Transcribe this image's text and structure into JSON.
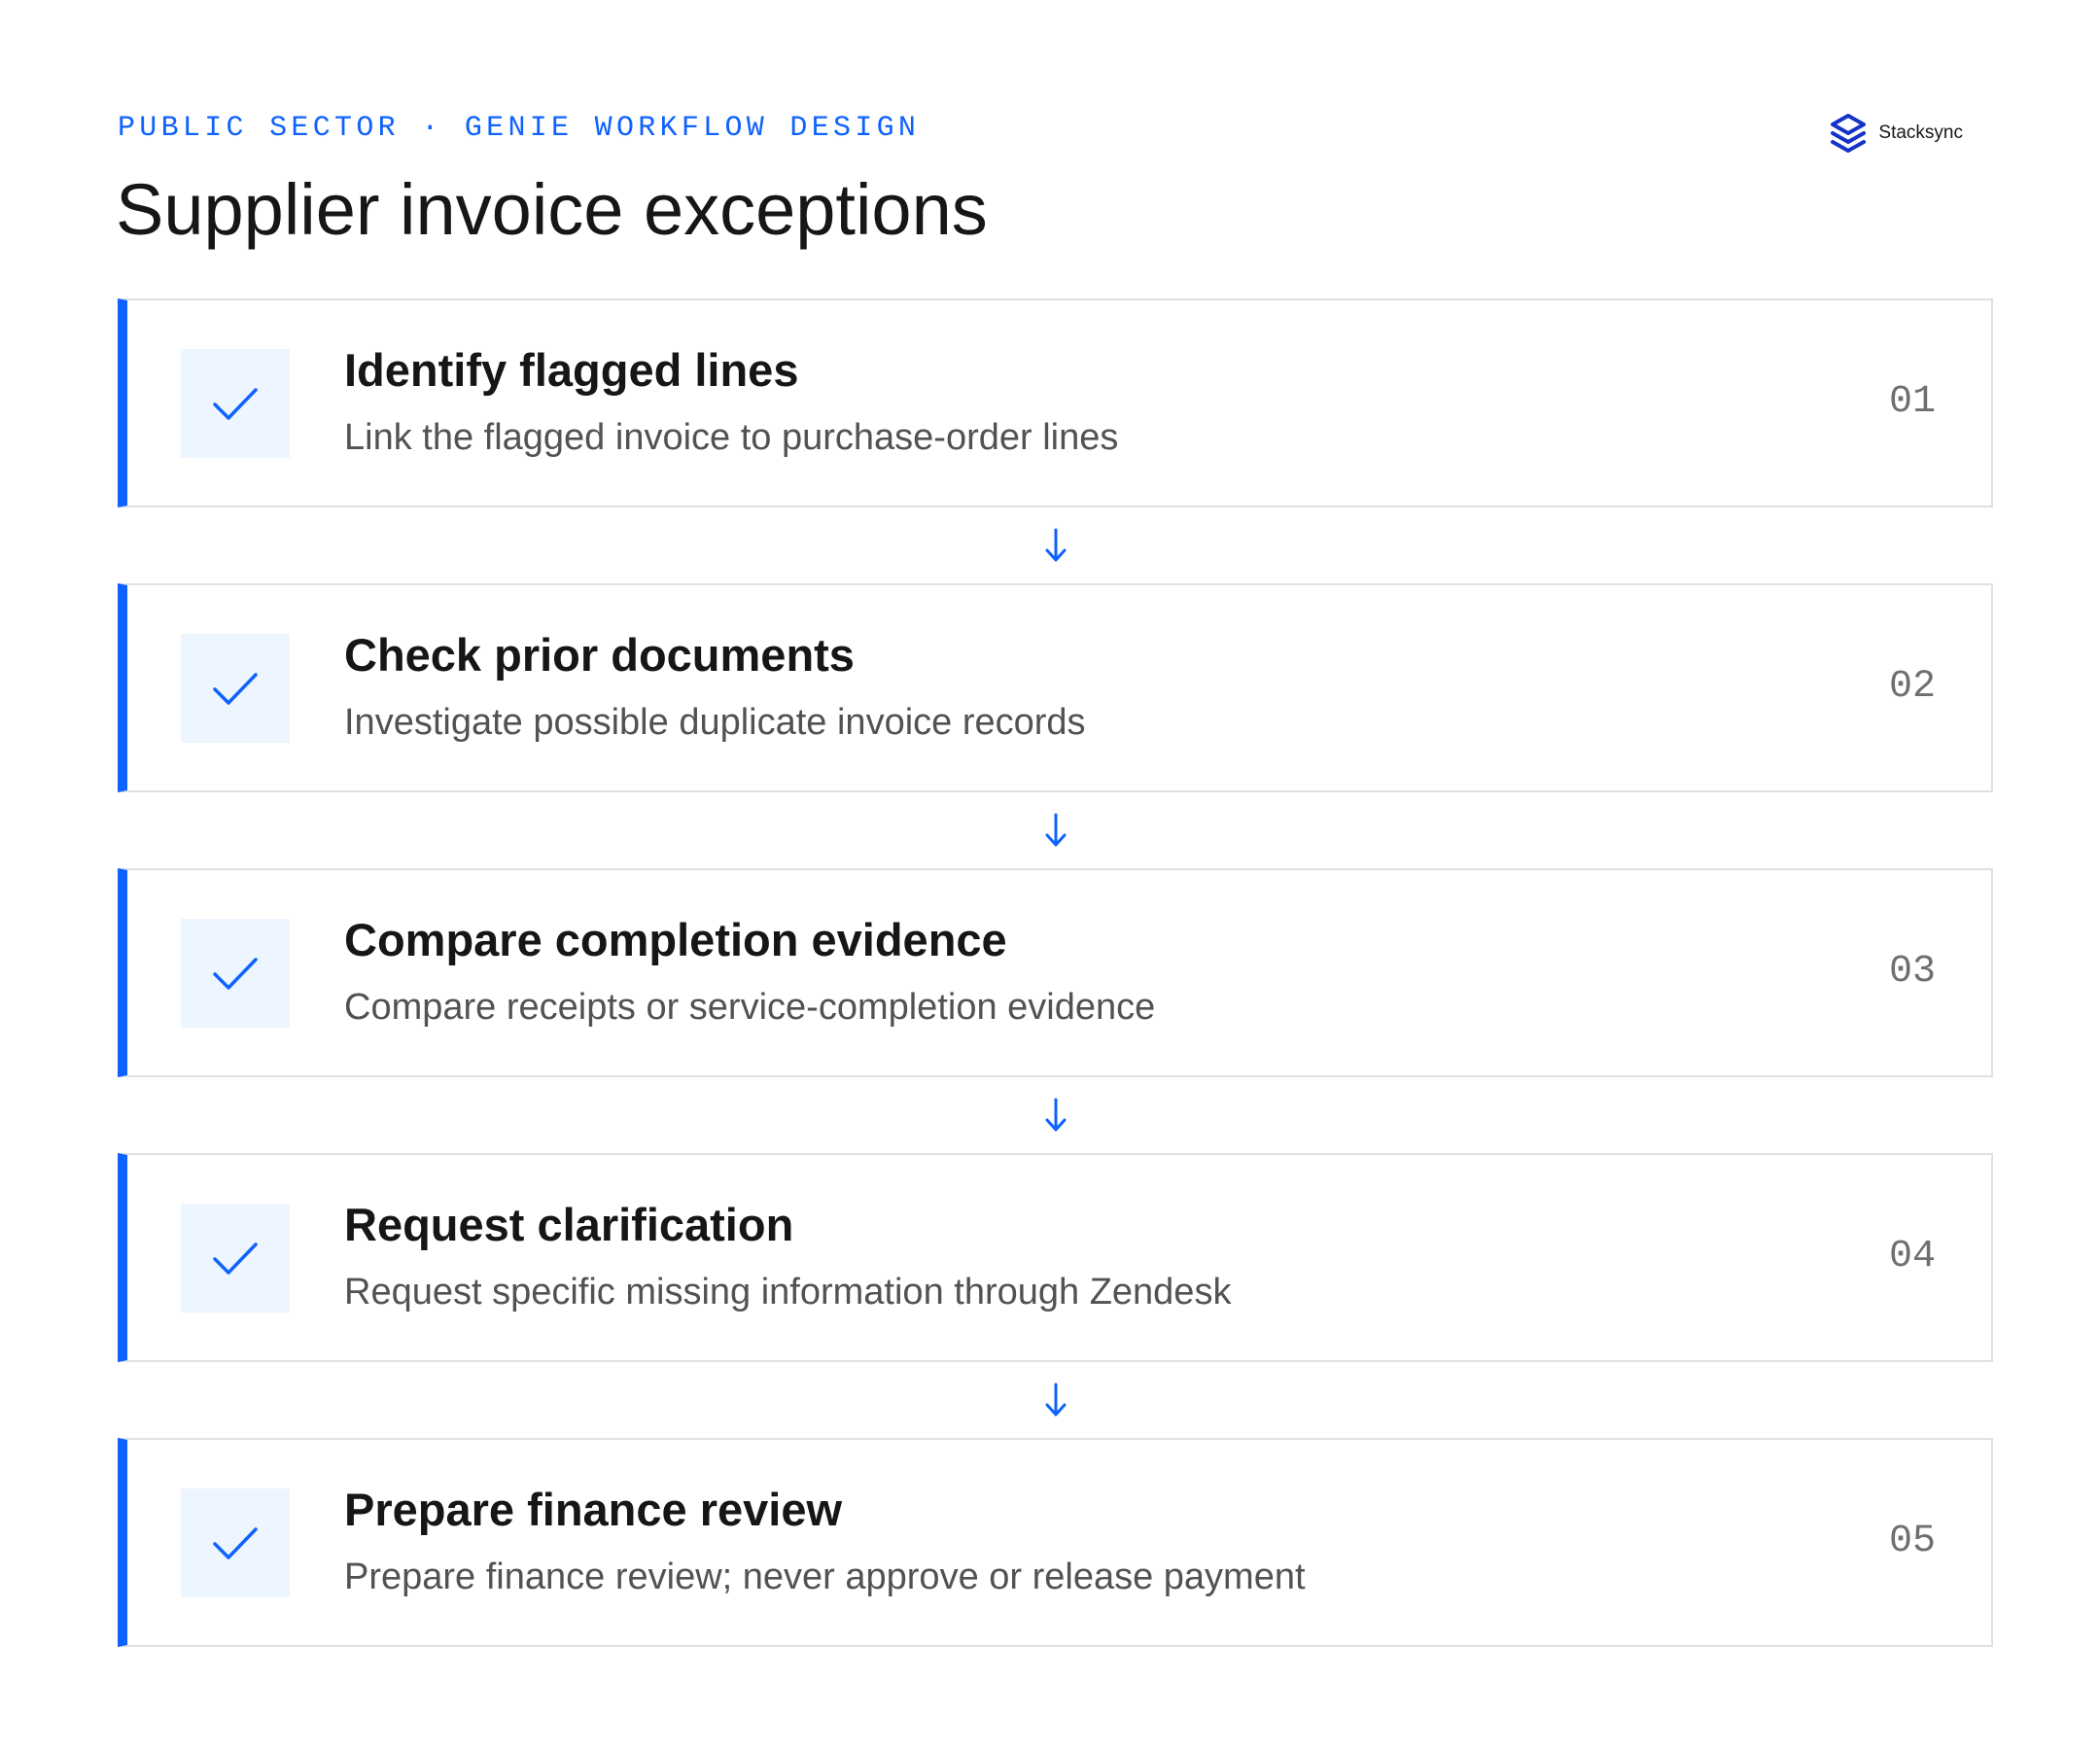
{
  "header": {
    "eyebrow": "PUBLIC SECTOR · GENIE WORKFLOW DESIGN",
    "title": "Supplier invoice exceptions"
  },
  "brand": {
    "name": "Stacksync",
    "icon": "stacksync-logo-icon",
    "color": "#1432c8"
  },
  "colors": {
    "accent": "#0f62fe",
    "check_tile": "#edf5ff",
    "card_border": "#dde1e6",
    "title_text": "#161616",
    "description_text": "#525252",
    "number_text": "#6f6f6f"
  },
  "steps": [
    {
      "title": "Identify flagged lines",
      "description": "Link the flagged invoice to purchase-order lines",
      "number": "01",
      "icon": "checkmark-icon",
      "done": true
    },
    {
      "title": "Check prior documents",
      "description": "Investigate possible duplicate invoice records",
      "number": "02",
      "icon": "checkmark-icon",
      "done": true
    },
    {
      "title": "Compare completion evidence",
      "description": "Compare receipts or service-completion evidence",
      "number": "03",
      "icon": "checkmark-icon",
      "done": true
    },
    {
      "title": "Request clarification",
      "description": "Request specific missing information through Zendesk",
      "number": "04",
      "icon": "checkmark-icon",
      "done": true
    },
    {
      "title": "Prepare finance review",
      "description": "Prepare finance review; never approve or release payment",
      "number": "05",
      "icon": "checkmark-icon",
      "done": true
    }
  ],
  "connector_icon": "arrow-down-icon"
}
